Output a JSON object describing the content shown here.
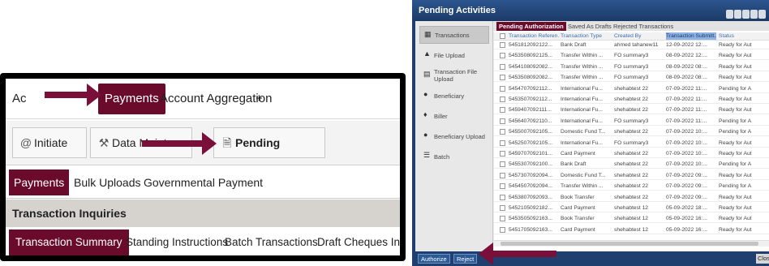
{
  "left": {
    "top_tabs": [
      {
        "label": "Ac"
      },
      {
        "label": "Payments"
      },
      {
        "label": "Account Aggregation"
      },
      {
        "label": "+"
      }
    ],
    "toolbar": {
      "initiate": "Initiate",
      "data_maintenance": "Data Mainter",
      "pending_activities": "Pending Activities"
    },
    "sub_tabs": [
      {
        "label": "Payments"
      },
      {
        "label": "Bulk Uploads"
      },
      {
        "label": "Governmental Payment"
      }
    ],
    "section_title": "Transaction Inquiries",
    "inquiry_tabs": [
      {
        "label": "Transaction Summary"
      },
      {
        "label": "Standing Instructions"
      },
      {
        "label": "Batch Transactions"
      },
      {
        "label": "Draft Cheques Inqui"
      }
    ]
  },
  "dialog": {
    "title": "Pending Activities",
    "sidebar": [
      {
        "label": "Transactions",
        "icon": "transactions-icon"
      },
      {
        "label": "File Upload",
        "icon": "file-upload-icon"
      },
      {
        "label": "Transaction File Upload",
        "icon": "file-icon"
      },
      {
        "label": "Beneficiary",
        "icon": "user-icon"
      },
      {
        "label": "Biller",
        "icon": "biller-icon"
      },
      {
        "label": "Beneficiary Upload",
        "icon": "user-icon"
      },
      {
        "label": "Batch",
        "icon": "batch-icon"
      }
    ],
    "tabs": [
      {
        "label": "Pending Authorization"
      },
      {
        "label": "Saved As Drafts"
      },
      {
        "label": "Rejected Transactions"
      }
    ],
    "columns": [
      "Transaction Referen...",
      "Transaction Type",
      "Created By",
      "Transaction Submitt...",
      "Status"
    ],
    "rows": [
      [
        "5451812092122...",
        "Bank Draft",
        "ahmed tahanew11",
        "12-09-2022 12:...",
        "Ready for Aut"
      ],
      [
        "5453508092125...",
        "Transfer Within ...",
        "FO summary3",
        "08-09-2022 12:...",
        "Ready for Aut"
      ],
      [
        "5454108092082...",
        "Transfer Within ...",
        "FO summary3",
        "08-09-2022 08:...",
        "Ready for Aut"
      ],
      [
        "5453508092082...",
        "Transfer Within ...",
        "FO summary3",
        "08-09-2022 08:...",
        "Ready for Aut"
      ],
      [
        "5454707092112...",
        "International Fu...",
        "shehabtest 22",
        "07-09-2022 11:...",
        "Pending for A"
      ],
      [
        "5453507092112...",
        "International Fu...",
        "shehabtest 22",
        "07-09-2022 11:...",
        "Ready for Aut"
      ],
      [
        "5459407092111...",
        "International Fu...",
        "shehabtest 22",
        "07-09-2022 11:...",
        "Ready for Aut"
      ],
      [
        "5456407092110...",
        "International Fu...",
        "FO summary3",
        "07-09-2022 11:...",
        "Pending for A"
      ],
      [
        "5455007092105...",
        "Domestic Fund T...",
        "shehabtest 22",
        "07-09-2022 10:...",
        "Pending for A"
      ],
      [
        "5452507092105...",
        "International Fu...",
        "FO summary3",
        "07-09-2022 10:...",
        "Ready for Aut"
      ],
      [
        "5459707092101...",
        "Card Payment",
        "shehabtest 22",
        "07-09-2022 10:...",
        "Ready for Aut"
      ],
      [
        "5455307092100...",
        "Bank Draft",
        "shehabtest 22",
        "07-09-2022 10:...",
        "Pending for A"
      ],
      [
        "5457307092094...",
        "Domestic Fund T...",
        "shehabtest 22",
        "07-09-2022 09:...",
        "Ready for Aut"
      ],
      [
        "5454507092094...",
        "Transfer Within ...",
        "shehabtest 22",
        "07-09-2022 09:...",
        "Pending for A"
      ],
      [
        "5453807092093...",
        "Book Transfer",
        "shehabtest 22",
        "07-09-2022 09:...",
        "Ready for Aut"
      ],
      [
        "5452105092182...",
        "Card Payment",
        "shehabtest 12",
        "05-09-2022 18:...",
        "Ready for Aut"
      ],
      [
        "5453505092163...",
        "Book Transfer",
        "shehabtest 12",
        "05-09-2022 16:...",
        "Ready for Aut"
      ],
      [
        "5451705092163...",
        "Card Payment",
        "shehabtest 12",
        "05-09-2022 16:...",
        "Ready for Aut"
      ]
    ],
    "footer": {
      "authorize": "Authorize",
      "reject": "Reject",
      "close": "Clos"
    }
  },
  "colors": {
    "accent": "#6b0b2c",
    "arrow": "#7a0f3a",
    "dialog_blue": "#1f3f6e",
    "header_highlight": "#8fb1e3"
  }
}
